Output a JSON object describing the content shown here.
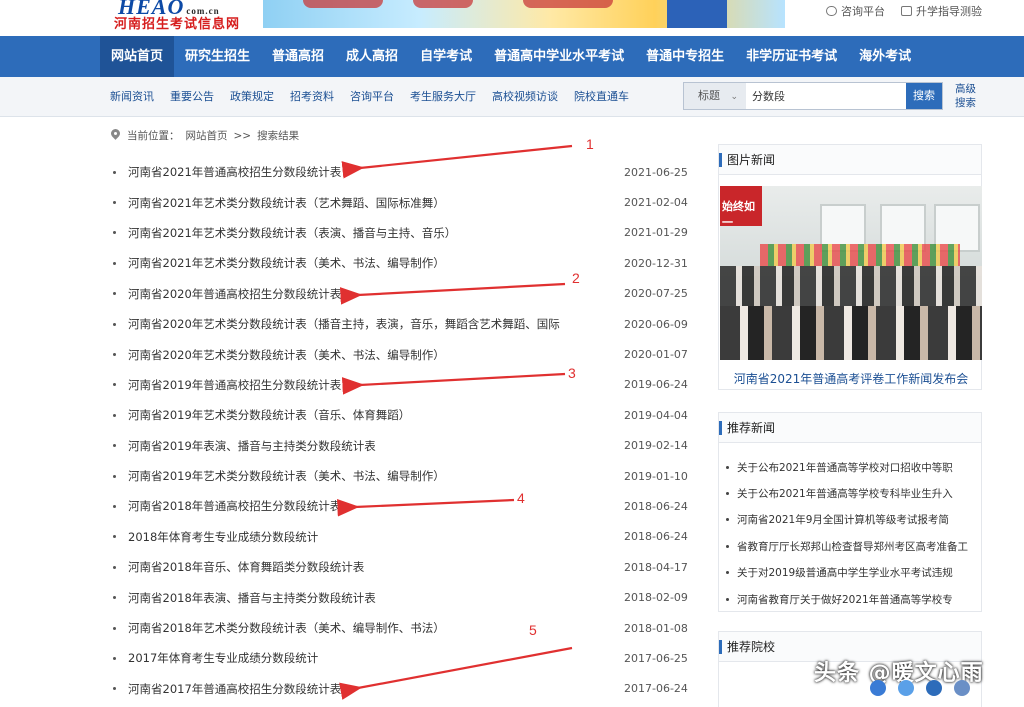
{
  "header": {
    "logo_mark": "HEAO",
    "logo_domain": "com.cn",
    "logo_text": "河南招生考试信息网",
    "links": [
      {
        "icon": "chat-icon",
        "label": "咨询平台"
      },
      {
        "icon": "document-icon",
        "label": "升学指导测验"
      }
    ]
  },
  "nav": {
    "items": [
      "网站首页",
      "研究生招生",
      "普通高招",
      "成人高招",
      "自学考试",
      "普通高中学业水平考试",
      "普通中专招生",
      "非学历证书考试",
      "海外考试"
    ],
    "active": "网站首页"
  },
  "subnav": {
    "items": [
      "新闻资讯",
      "重要公告",
      "政策规定",
      "招考资料",
      "咨询平台",
      "考生服务大厅",
      "高校视频访谈",
      "院校直通车"
    ]
  },
  "search": {
    "field_type": "标题",
    "query": "分数段",
    "button": "搜索",
    "advanced": "高级搜索"
  },
  "breadcrumb": {
    "prefix": "当前位置：",
    "home": "网站首页",
    "separator": ">>",
    "current": "搜索结果"
  },
  "results": [
    {
      "title": "河南省2021年普通高校招生分数段统计表",
      "date": "2021-06-25"
    },
    {
      "title": "河南省2021年艺术类分数段统计表（艺术舞蹈、国际标准舞）",
      "date": "2021-02-04"
    },
    {
      "title": "河南省2021年艺术类分数段统计表（表演、播音与主持、音乐）",
      "date": "2021-01-29"
    },
    {
      "title": "河南省2021年艺术类分数段统计表（美术、书法、编导制作）",
      "date": "2020-12-31"
    },
    {
      "title": "河南省2020年普通高校招生分数段统计表",
      "date": "2020-07-25"
    },
    {
      "title": "河南省2020年艺术类分数段统计表（播音主持，表演，音乐，舞蹈含艺术舞蹈、国际",
      "date": "2020-06-09"
    },
    {
      "title": "河南省2020年艺术类分数段统计表（美术、书法、编导制作）",
      "date": "2020-01-07"
    },
    {
      "title": "河南省2019年普通高校招生分数段统计表",
      "date": "2019-06-24"
    },
    {
      "title": "河南省2019年艺术类分数段统计表（音乐、体育舞蹈）",
      "date": "2019-04-04"
    },
    {
      "title": "河南省2019年表演、播音与主持类分数段统计表",
      "date": "2019-02-14"
    },
    {
      "title": "河南省2019年艺术类分数段统计表（美术、书法、编导制作）",
      "date": "2019-01-10"
    },
    {
      "title": "河南省2018年普通高校招生分数段统计表",
      "date": "2018-06-24"
    },
    {
      "title": "2018年体育考生专业成绩分数段统计",
      "date": "2018-06-24"
    },
    {
      "title": "河南省2018年音乐、体育舞蹈类分数段统计表",
      "date": "2018-04-17"
    },
    {
      "title": "河南省2018年表演、播音与主持类分数段统计表",
      "date": "2018-02-09"
    },
    {
      "title": "河南省2018年艺术类分数段统计表（美术、编导制作、书法）",
      "date": "2018-01-08"
    },
    {
      "title": "2017年体育考生专业成绩分数段统计",
      "date": "2017-06-25"
    },
    {
      "title": "河南省2017年普通高校招生分数段统计表",
      "date": "2017-06-24"
    }
  ],
  "annotations": [
    "1",
    "2",
    "3",
    "4",
    "5"
  ],
  "annotation_color": "#e03030",
  "sidebar": {
    "photo_news": {
      "title": "图片新闻",
      "banner_text": "始终如一",
      "caption": "河南省2021年普通高考评卷工作新闻发布会"
    },
    "recommended_news": {
      "title": "推荐新闻",
      "items": [
        "关于公布2021年普通高等学校对口招收中等职",
        "关于公布2021年普通高等学校专科毕业生升入",
        "河南省2021年9月全国计算机等级考试报考简",
        "省教育厅厅长郑邦山检查督导郑州考区高考准备工",
        "关于对2019级普通高中学生学业水平考试违规",
        "河南省教育厅关于做好2021年普通高等学校专"
      ]
    },
    "recommended_schools": {
      "title": "推荐院校"
    }
  },
  "watermark": "头条 @暖文心雨",
  "colors": {
    "nav": "#2d6cba",
    "link": "#1b4f93",
    "brand_red": "#d61d1d"
  }
}
